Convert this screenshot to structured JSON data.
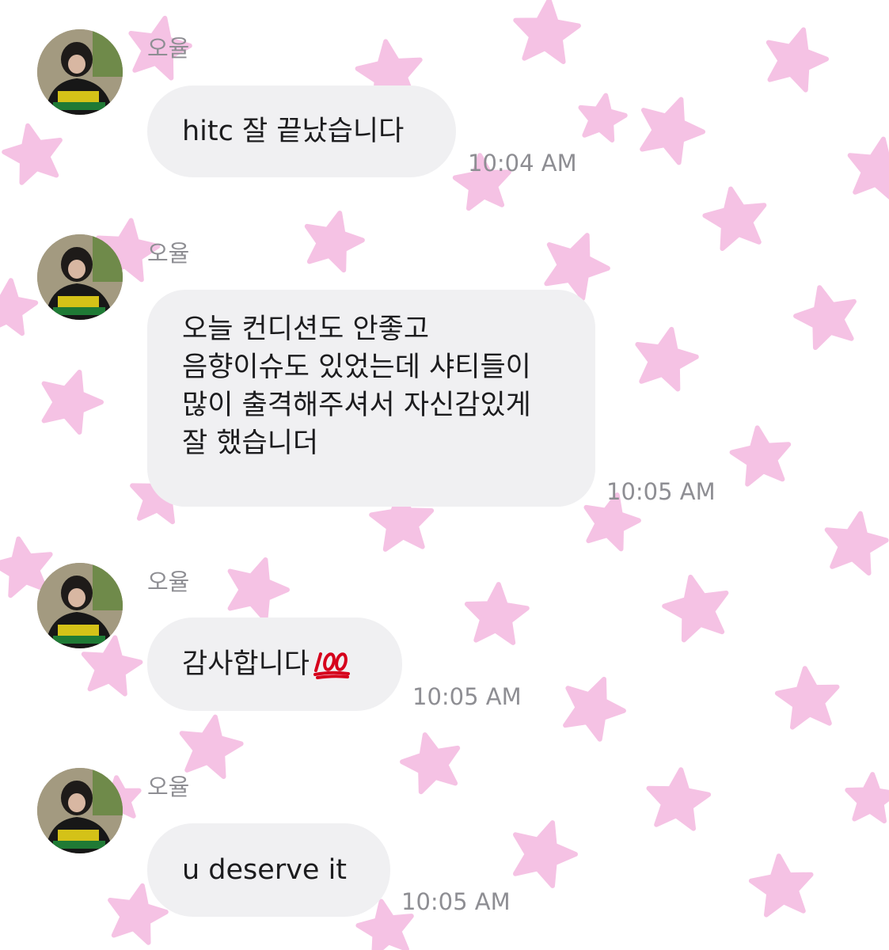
{
  "colors": {
    "background": "#ffffff",
    "star": "#f5c2e4",
    "bubble": "#f0f0f2",
    "message_text": "#1c1c1e",
    "meta_text": "#8e8e93",
    "emoji_red": "#d6001c"
  },
  "messages": [
    {
      "sender": "오율",
      "lines": [
        "hitc 잘 끝났습니다"
      ],
      "time": "10:04 AM",
      "avatar": "profile-photo"
    },
    {
      "sender": "오율",
      "lines": [
        "오늘 컨디션도 안좋고",
        "음향이슈도 있었는데 샤티들이",
        "많이 출격해주셔서 자신감있게",
        "잘 했습니더"
      ],
      "time": "10:05 AM",
      "avatar": "profile-photo"
    },
    {
      "sender": "오율",
      "lines": [
        "감사합니다"
      ],
      "emoji": "hundred-points-icon",
      "time": "10:05 AM",
      "avatar": "profile-photo"
    },
    {
      "sender": "오율",
      "lines": [
        "u deserve it"
      ],
      "time": "10:05 AM",
      "avatar": "profile-photo"
    }
  ]
}
